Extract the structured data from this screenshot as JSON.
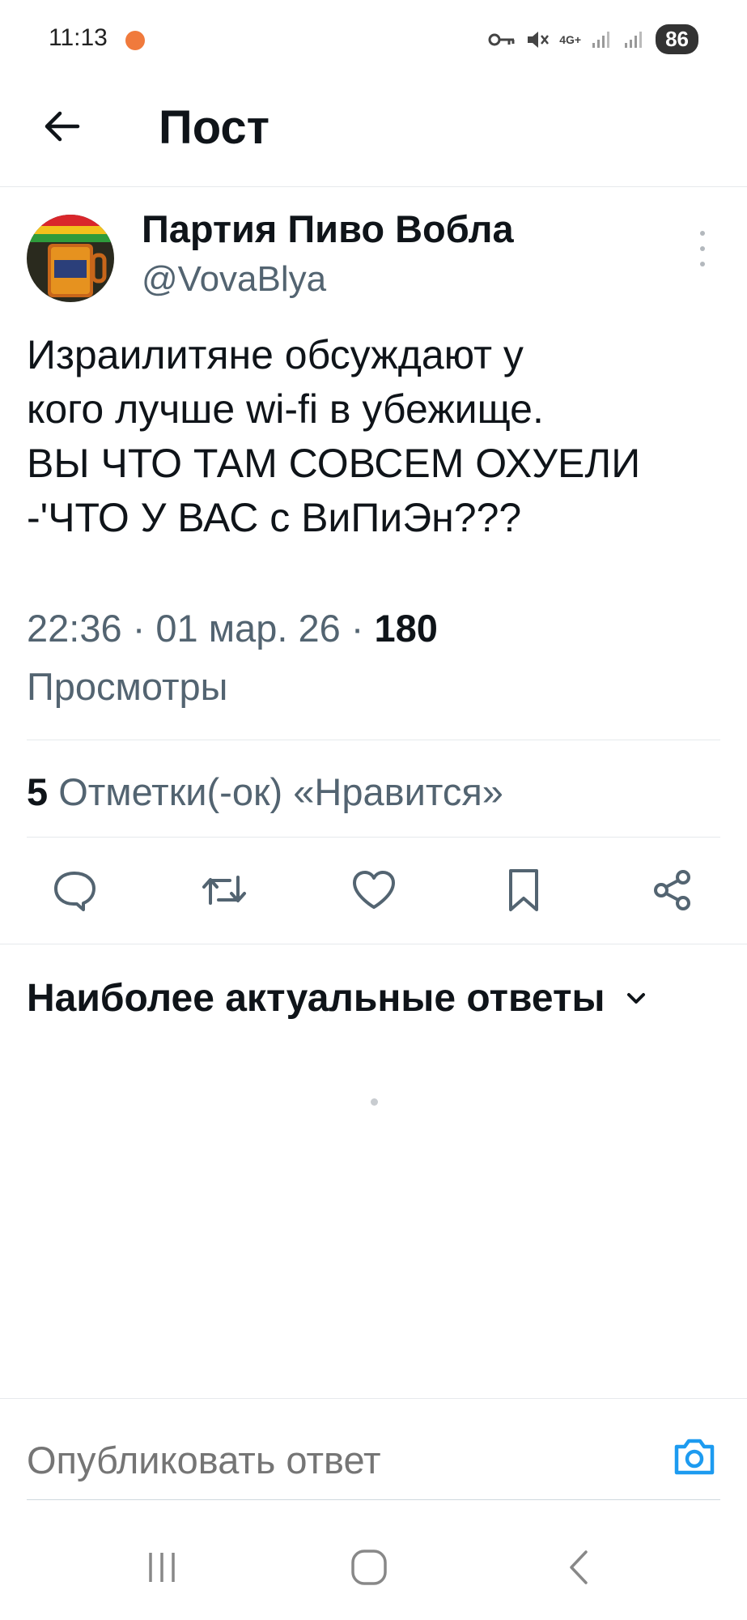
{
  "status_bar": {
    "time": "11:13",
    "network": "4G+",
    "battery": "86"
  },
  "header": {
    "title": "Пост"
  },
  "post": {
    "author_name": "Партия Пиво Вобла",
    "author_handle": "@VovaBlya",
    "text": "Израилитяне обсуждают у\nкого лучше wi-fi в убежище.\nВЫ ЧТО ТАМ СОВСЕМ ОХУЕЛИ\n-'ЧТО У ВАС с ВиПиЭн???",
    "time": "22:36",
    "date": "01 мар. 26",
    "views_count": "180",
    "views_label": "Просмотры",
    "likes_count": "5",
    "likes_label": "Отметки(-ок) «Нравится»"
  },
  "actions": [
    "reply-icon",
    "retweet-icon",
    "like-icon",
    "bookmark-icon",
    "share-icon"
  ],
  "replies": {
    "sort_label": "Наиболее актуальные ответы"
  },
  "composer": {
    "placeholder": "Опубликовать ответ"
  },
  "colors": {
    "text": "#0f1419",
    "secondary": "#536471",
    "accent": "#1d9bf0",
    "divider": "#e6e9ec"
  }
}
